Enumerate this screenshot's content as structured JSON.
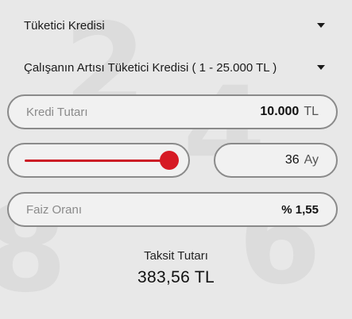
{
  "loan_type": {
    "selected": "Tüketici Kredisi"
  },
  "loan_product": {
    "selected": "Çalışanın Artısı Tüketici Kredisi ( 1 - 25.000 TL )"
  },
  "amount": {
    "label": "Kredi Tutarı",
    "value": "10.000",
    "unit": "TL"
  },
  "term": {
    "value": "36",
    "unit": "Ay",
    "slider_level": 1.0
  },
  "interest": {
    "label": "Faiz Oranı",
    "value": "% 1,55"
  },
  "installment": {
    "label": "Taksit Tutarı",
    "value": "383,56 TL"
  },
  "colors": {
    "accent": "#d61a24",
    "border": "#8a8a8a",
    "background": "#e8e8e8"
  }
}
